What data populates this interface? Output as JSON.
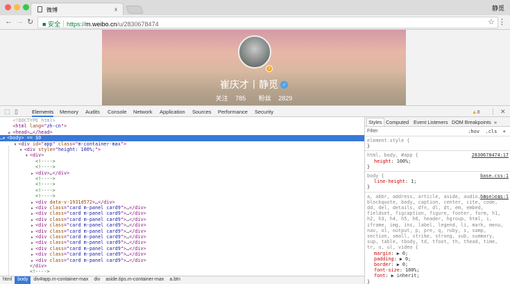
{
  "browser": {
    "tab_title": "微博",
    "tab_close": "x",
    "profile_name": "静觅",
    "secure_label": "安全",
    "url_scheme": "https://",
    "url_host": "m.weibo.cn",
    "url_path": "/u/2830678474",
    "icons": [
      "back-arrow",
      "forward-arrow",
      "reload",
      "lock",
      "star",
      "kebab-menu"
    ]
  },
  "profile": {
    "name": "崔庆才丨静觅",
    "following_label": "关注",
    "following": "785",
    "followers_label": "粉丝",
    "followers": "2829",
    "verified_color": "#f5a623",
    "gender": "male"
  },
  "devtools": {
    "tabs": [
      "Elements",
      "Memory",
      "Audits",
      "Console",
      "Network",
      "Application",
      "Sources",
      "Performance",
      "Security"
    ],
    "active_tab": "Elements",
    "warnings": "8",
    "tree": [
      {
        "i": 0,
        "a": "",
        "p": [
          [
            "dt",
            "<!DOCTYPE html>"
          ]
        ]
      },
      {
        "i": 0,
        "a": "",
        "p": [
          [
            "tg",
            "<html "
          ],
          [
            "an",
            "lang"
          ],
          [
            "tg",
            "=\""
          ],
          [
            "av",
            "zh-cn"
          ],
          [
            "tg",
            "\">"
          ]
        ]
      },
      {
        "i": 0,
        "a": "▶",
        "p": [
          [
            "tg",
            "<head>"
          ],
          [
            "pl",
            "…"
          ],
          [
            "tg",
            "</head>"
          ]
        ]
      },
      {
        "i": 0,
        "a": "▼",
        "sel": true,
        "pre": "…",
        "p": [
          [
            "tg",
            "<body>"
          ],
          [
            "pl",
            " == $0"
          ]
        ]
      },
      {
        "i": 1,
        "a": "▼",
        "p": [
          [
            "tg",
            "<div "
          ],
          [
            "an",
            "id"
          ],
          [
            "tg",
            "=\""
          ],
          [
            "av",
            "app"
          ],
          [
            "tg",
            "\" "
          ],
          [
            "an",
            "class"
          ],
          [
            "tg",
            "=\""
          ],
          [
            "av",
            "m-container-max"
          ],
          [
            "tg",
            "\">"
          ]
        ]
      },
      {
        "i": 2,
        "a": "▼",
        "p": [
          [
            "tg",
            "<div "
          ],
          [
            "an",
            "style"
          ],
          [
            "tg",
            "=\""
          ],
          [
            "av",
            "height: 100%;"
          ],
          [
            "tg",
            "\">"
          ]
        ]
      },
      {
        "i": 3,
        "a": "▼",
        "p": [
          [
            "tg",
            "<div>"
          ]
        ]
      },
      {
        "i": 4,
        "a": "",
        "p": [
          [
            "cm",
            "<!---->"
          ]
        ]
      },
      {
        "i": 4,
        "a": "",
        "p": [
          [
            "cm",
            "<!---->"
          ]
        ]
      },
      {
        "i": 4,
        "a": "▶",
        "p": [
          [
            "tg",
            "<div>"
          ],
          [
            "pl",
            "…"
          ],
          [
            "tg",
            "</div>"
          ]
        ]
      },
      {
        "i": 4,
        "a": "",
        "p": [
          [
            "cm",
            "<!---->"
          ]
        ]
      },
      {
        "i": 4,
        "a": "",
        "p": [
          [
            "cm",
            "<!---->"
          ]
        ]
      },
      {
        "i": 4,
        "a": "",
        "p": [
          [
            "cm",
            "<!---->"
          ]
        ]
      },
      {
        "i": 4,
        "a": "",
        "p": [
          [
            "cm",
            "<!---->"
          ]
        ]
      },
      {
        "i": 4,
        "a": "▶",
        "p": [
          [
            "tg",
            "<div "
          ],
          [
            "an",
            "data-v-1931d572"
          ],
          [
            "tg",
            ">"
          ],
          [
            "pl",
            "…"
          ],
          [
            "tg",
            "</div>"
          ]
        ]
      },
      {
        "i": 4,
        "a": "▶",
        "p": [
          [
            "tg",
            "<div "
          ],
          [
            "an",
            "class"
          ],
          [
            "tg",
            "=\""
          ],
          [
            "av",
            "card m-panel card9"
          ],
          [
            "tg",
            "\">"
          ],
          [
            "pl",
            "…"
          ],
          [
            "tg",
            "</div>"
          ]
        ]
      },
      {
        "i": 4,
        "a": "▶",
        "p": [
          [
            "tg",
            "<div "
          ],
          [
            "an",
            "class"
          ],
          [
            "tg",
            "=\""
          ],
          [
            "av",
            "card m-panel card9"
          ],
          [
            "tg",
            "\">"
          ],
          [
            "pl",
            "…"
          ],
          [
            "tg",
            "</div>"
          ]
        ]
      },
      {
        "i": 4,
        "a": "▶",
        "p": [
          [
            "tg",
            "<div "
          ],
          [
            "an",
            "class"
          ],
          [
            "tg",
            "=\""
          ],
          [
            "av",
            "card m-panel card9"
          ],
          [
            "tg",
            "\">"
          ],
          [
            "pl",
            "…"
          ],
          [
            "tg",
            "</div>"
          ]
        ]
      },
      {
        "i": 4,
        "a": "▶",
        "p": [
          [
            "tg",
            "<div "
          ],
          [
            "an",
            "class"
          ],
          [
            "tg",
            "=\""
          ],
          [
            "av",
            "card m-panel card9"
          ],
          [
            "tg",
            "\">"
          ],
          [
            "pl",
            "…"
          ],
          [
            "tg",
            "</div>"
          ]
        ]
      },
      {
        "i": 4,
        "a": "▶",
        "p": [
          [
            "tg",
            "<div "
          ],
          [
            "an",
            "class"
          ],
          [
            "tg",
            "=\""
          ],
          [
            "av",
            "card m-panel card9"
          ],
          [
            "tg",
            "\">"
          ],
          [
            "pl",
            "…"
          ],
          [
            "tg",
            "</div>"
          ]
        ]
      },
      {
        "i": 4,
        "a": "▶",
        "p": [
          [
            "tg",
            "<div "
          ],
          [
            "an",
            "class"
          ],
          [
            "tg",
            "=\""
          ],
          [
            "av",
            "card m-panel card9"
          ],
          [
            "tg",
            "\">"
          ],
          [
            "pl",
            "…"
          ],
          [
            "tg",
            "</div>"
          ]
        ]
      },
      {
        "i": 4,
        "a": "▶",
        "p": [
          [
            "tg",
            "<div "
          ],
          [
            "an",
            "class"
          ],
          [
            "tg",
            "=\""
          ],
          [
            "av",
            "card m-panel card9"
          ],
          [
            "tg",
            "\">"
          ],
          [
            "pl",
            "…"
          ],
          [
            "tg",
            "</div>"
          ]
        ]
      },
      {
        "i": 4,
        "a": "▶",
        "p": [
          [
            "tg",
            "<div "
          ],
          [
            "an",
            "class"
          ],
          [
            "tg",
            "=\""
          ],
          [
            "av",
            "card m-panel card9"
          ],
          [
            "tg",
            "\">"
          ],
          [
            "pl",
            "…"
          ],
          [
            "tg",
            "</div>"
          ]
        ]
      },
      {
        "i": 4,
        "a": "▶",
        "p": [
          [
            "tg",
            "<div "
          ],
          [
            "an",
            "class"
          ],
          [
            "tg",
            "=\""
          ],
          [
            "av",
            "card m-panel card9"
          ],
          [
            "tg",
            "\">"
          ],
          [
            "pl",
            "…"
          ],
          [
            "tg",
            "</div>"
          ]
        ]
      },
      {
        "i": 4,
        "a": "▶",
        "p": [
          [
            "tg",
            "<div "
          ],
          [
            "an",
            "class"
          ],
          [
            "tg",
            "=\""
          ],
          [
            "av",
            "card m-panel card9"
          ],
          [
            "tg",
            "\">"
          ],
          [
            "pl",
            "…"
          ],
          [
            "tg",
            "</div>"
          ]
        ]
      },
      {
        "i": 3,
        "a": "",
        "p": [
          [
            "tg",
            "</div>"
          ]
        ]
      },
      {
        "i": 3,
        "a": "",
        "p": [
          [
            "cm",
            "<!---->"
          ]
        ]
      }
    ],
    "breadcrumbs": [
      "html",
      "body",
      "div#app.m-container-max",
      "div",
      "aside.tips.m-container-max",
      "a.btn"
    ],
    "active_crumb": "body",
    "side_tabs": [
      "Styles",
      "Computed",
      "Event Listeners",
      "DOM Breakpoints",
      "»"
    ],
    "filter_placeholder": "Filter",
    "filter_hov": ":hov",
    "filter_cls": ".cls",
    "filter_add": "+",
    "rules": [
      {
        "selector": "element.style {",
        "source": "",
        "props": []
      },
      {
        "selector": "html, body, #app {",
        "source": "2830678474:17",
        "props": [
          [
            "height",
            "100%;"
          ]
        ]
      },
      {
        "selector": "body {",
        "source": "base.css:1",
        "props": [
          [
            "line-height",
            "1;"
          ]
        ]
      },
      {
        "selector": "a, abbr, address, article, aside, audio, b, big, blockquote, body, caption, center, cite, code, dd, del, details, dfn, dl, dt, em, embed, fieldset, figcaption, figure, footer, form, h1, h2, h3, h4, h5, h6, header, hgroup, html, i, iframe, img, ins, label, legend, li, mark, menu, nav, ol, output, p, pre, q, ruby, s, samp, section, small, strike, strong, sub, summary, sup, table, tbody, td, tfoot, th, thead, time, tr, u, ul, video {",
        "source": "base.css:1",
        "props": [
          [
            "margin",
            "▶ 0;"
          ],
          [
            "padding",
            "▶ 0;"
          ],
          [
            "border",
            "▶ 0;"
          ],
          [
            "font-size",
            "100%;"
          ],
          [
            "font",
            "▶ inherit;"
          ]
        ]
      }
    ]
  }
}
